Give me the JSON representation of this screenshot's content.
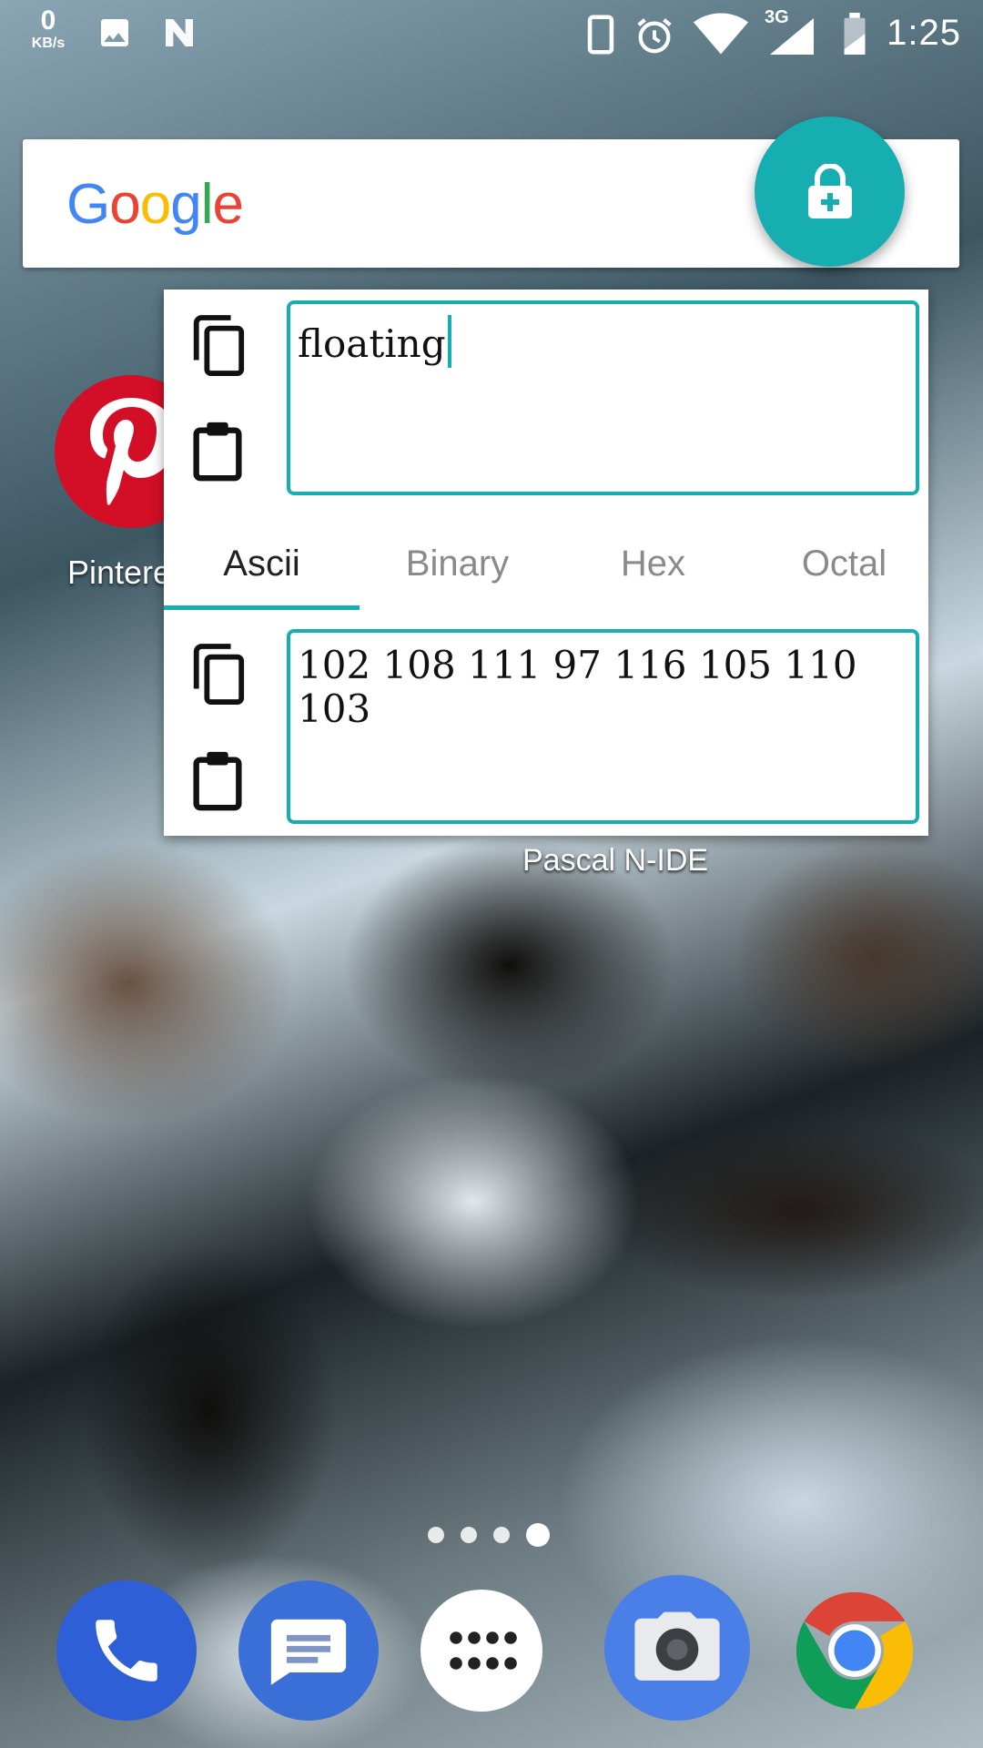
{
  "status_bar": {
    "net_speed_value": "0",
    "net_speed_unit": "KB/s",
    "network_type": "3G",
    "time": "1:25",
    "icons": [
      "image-icon",
      "n-icon",
      "phone-icon",
      "alarm-icon",
      "wifi-icon",
      "signal-icon",
      "battery-icon"
    ]
  },
  "search_bar": {
    "logo_letters": [
      {
        "char": "G",
        "color": "#4285f4"
      },
      {
        "char": "o",
        "color": "#ea4335"
      },
      {
        "char": "o",
        "color": "#fbbc05"
      },
      {
        "char": "g",
        "color": "#4285f4"
      },
      {
        "char": "l",
        "color": "#34a853"
      },
      {
        "char": "e",
        "color": "#ea4335"
      }
    ]
  },
  "home": {
    "pinterest_label": "Pintere",
    "app_label": "Pascal N-IDE"
  },
  "converter": {
    "input_text": "floating",
    "output_text": "102 108 111 97 116 105 110 103",
    "tabs": [
      "Ascii",
      "Binary",
      "Hex",
      "Octal"
    ],
    "active_tab": "Ascii",
    "accent_color": "#17aeb2"
  },
  "dock": {
    "apps": [
      "phone",
      "messages",
      "app-drawer",
      "camera",
      "chrome"
    ]
  }
}
